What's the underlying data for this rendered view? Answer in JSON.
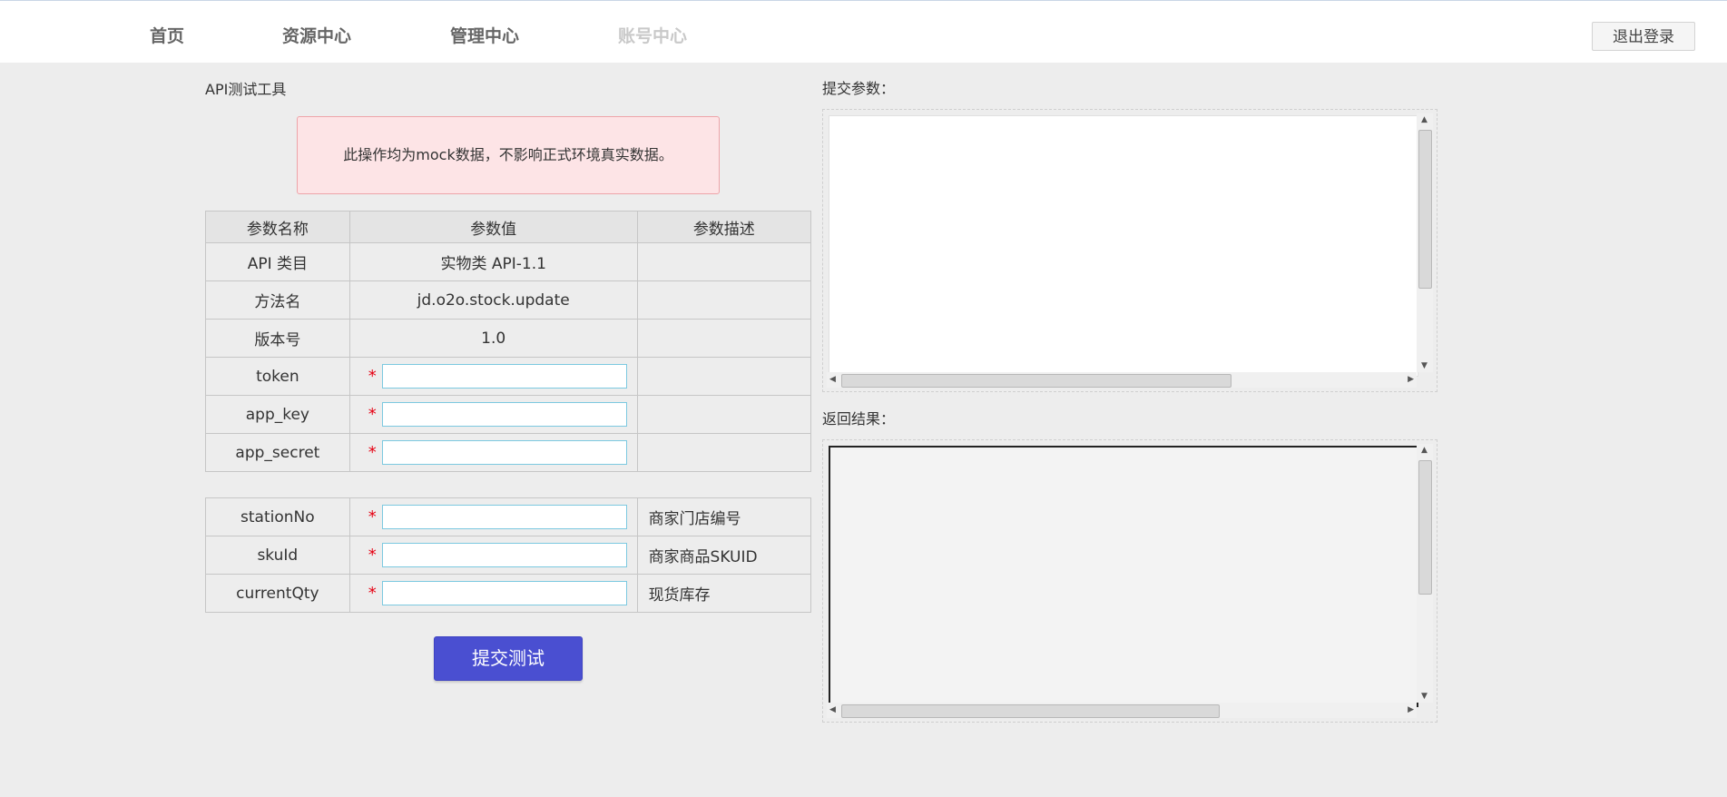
{
  "nav": {
    "items": [
      {
        "label": "首页",
        "disabled": false
      },
      {
        "label": "资源中心",
        "disabled": false
      },
      {
        "label": "管理中心",
        "disabled": false
      },
      {
        "label": "账号中心",
        "disabled": true
      }
    ],
    "logout_label": "退出登录"
  },
  "tool": {
    "title": "API测试工具",
    "notice": "此操作均为mock数据，不影响正式环境真实数据。"
  },
  "table": {
    "headers": [
      "参数名称",
      "参数值",
      "参数描述"
    ],
    "info_rows": [
      {
        "name": "API 类目",
        "value": "实物类 API-1.1",
        "desc": ""
      },
      {
        "name": "方法名",
        "value": "jd.o2o.stock.update",
        "desc": ""
      },
      {
        "name": "版本号",
        "value": "1.0",
        "desc": ""
      }
    ],
    "required_marker": "*",
    "auth_rows": [
      {
        "name": "token",
        "value": "",
        "desc": ""
      },
      {
        "name": "app_key",
        "value": "",
        "desc": ""
      },
      {
        "name": "app_secret",
        "value": "",
        "desc": ""
      }
    ]
  },
  "business_params": [
    {
      "name": "stationNo",
      "value": "",
      "desc": "商家门店编号"
    },
    {
      "name": "skuId",
      "value": "",
      "desc": "商家商品SKUID"
    },
    {
      "name": "currentQty",
      "value": "",
      "desc": "现货库存"
    }
  ],
  "submit_label": "提交测试",
  "right": {
    "submit_params_label": "提交参数：",
    "result_label": "返回结果：",
    "submit_params_value": "",
    "result_value": ""
  }
}
